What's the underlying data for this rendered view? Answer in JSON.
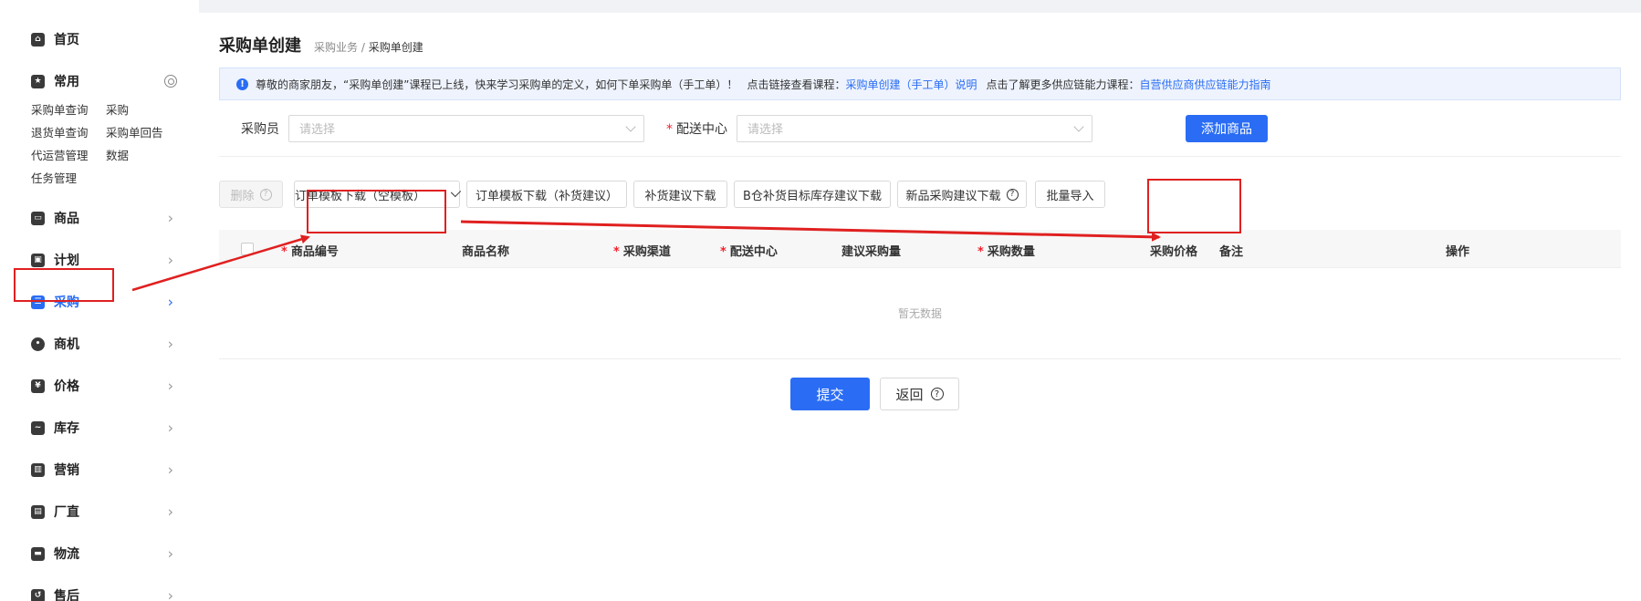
{
  "sidebar": {
    "items": [
      {
        "label": "首页",
        "icon": "home-icon"
      },
      {
        "label": "常用",
        "icon": "star-icon"
      },
      {
        "label": "商品",
        "icon": "goods-icon"
      },
      {
        "label": "计划",
        "icon": "plan-icon"
      },
      {
        "label": "采购",
        "icon": "purchase-icon"
      },
      {
        "label": "商机",
        "icon": "bulb-icon"
      },
      {
        "label": "价格",
        "icon": "price-icon"
      },
      {
        "label": "库存",
        "icon": "inventory-icon"
      },
      {
        "label": "营销",
        "icon": "marketing-icon"
      },
      {
        "label": "厂直",
        "icon": "factory-icon"
      },
      {
        "label": "物流",
        "icon": "truck-icon"
      },
      {
        "label": "售后",
        "icon": "aftersale-icon"
      }
    ],
    "active": "采购",
    "common_links": [
      "采购单查询",
      "采购",
      "退货单查询",
      "采购单回告",
      "代运营管理",
      "数据",
      "任务管理"
    ]
  },
  "header": {
    "title": "采购单创建",
    "breadcrumb_parent": "采购业务",
    "breadcrumb_sep": " / ",
    "breadcrumb_current": "采购单创建"
  },
  "notice": {
    "text1": "尊敬的商家朋友，“采购单创建”课程已上线，快来学习采购单的定义，如何下单采购单（手工单）！",
    "text2": "点击链接查看课程：",
    "link1": "采购单创建（手工单）说明",
    "text3": "点击了解更多供应链能力课程：",
    "link2": "自营供应商供应链能力指南"
  },
  "form": {
    "buyer_label": "采购员",
    "buyer_placeholder": "请选择",
    "dc_required": "*",
    "dc_label": "配送中心",
    "dc_placeholder": "请选择",
    "add_button": "添加商品"
  },
  "toolbar": {
    "delete": "删除",
    "template_empty": "订单模板下载（空模板）",
    "template_replenish": "订单模板下载（补货建议）",
    "replenish_download": "补货建议下载",
    "b_warehouse": "B仓补货目标库存建议下载",
    "new_product": "新品采购建议下载",
    "batch_import": "批量导入"
  },
  "table": {
    "columns": [
      {
        "label": "商品编号",
        "required": true
      },
      {
        "label": "商品名称",
        "required": false
      },
      {
        "label": "采购渠道",
        "required": true
      },
      {
        "label": "配送中心",
        "required": true
      },
      {
        "label": "建议采购量",
        "required": false
      },
      {
        "label": "采购数量",
        "required": true
      },
      {
        "label": "采购价格",
        "required": false
      },
      {
        "label": "备注",
        "required": false
      },
      {
        "label": "操作",
        "required": false
      }
    ],
    "empty_text": "暂无数据"
  },
  "actions": {
    "submit": "提交",
    "back": "返回"
  },
  "colors": {
    "primary": "#2a6df4",
    "annotation": "#e02020",
    "required": "#f5222d"
  }
}
